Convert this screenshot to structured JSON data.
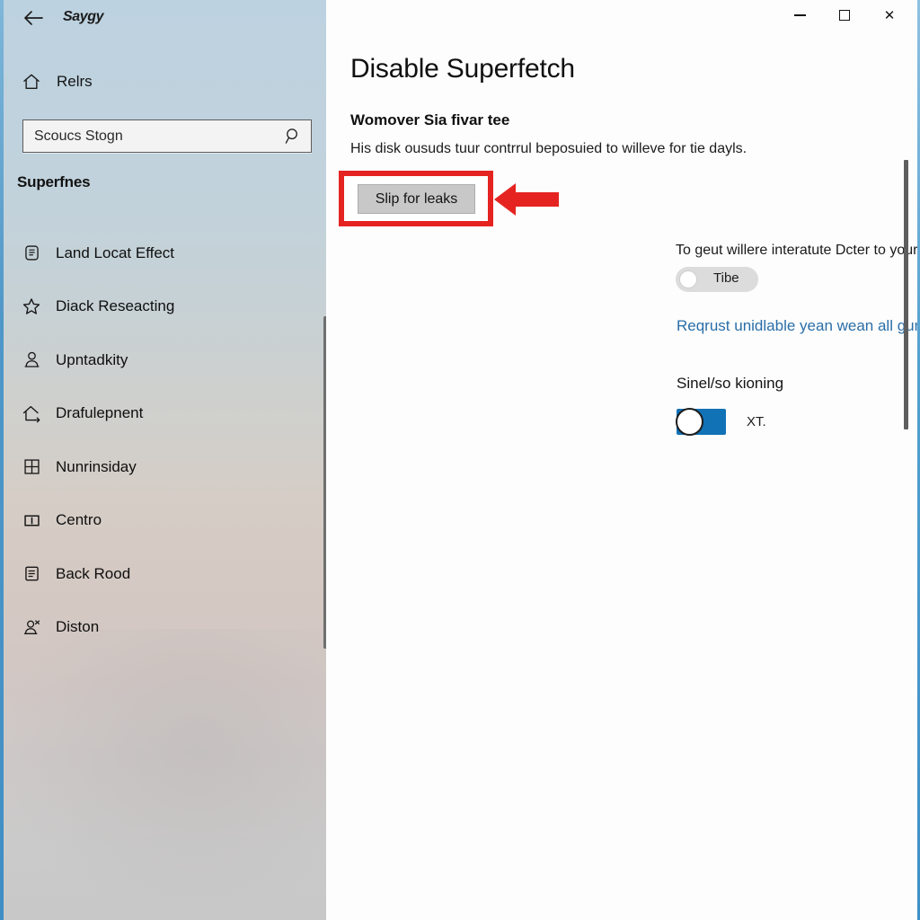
{
  "window": {
    "title": "Saygy",
    "back_icon": "back-arrow-icon",
    "minimize_label": "Minimize",
    "maximize_label": "Maximize",
    "close_label": "Close",
    "close_glyph": "✕"
  },
  "sidebar": {
    "home": {
      "label": "Relrs",
      "icon": "home-icon"
    },
    "search": {
      "value": "Scoucs Stogn",
      "placeholder": "Scoucs Stogn",
      "icon": "search-icon"
    },
    "group_header": "Superfnes",
    "items": [
      {
        "label": "Land Locat Effect",
        "icon": "badge-icon"
      },
      {
        "label": "Diack Reseacting",
        "icon": "star-icon"
      },
      {
        "label": "Upntadkity",
        "icon": "person-icon"
      },
      {
        "label": "Drafulepnent",
        "icon": "home-upload-icon"
      },
      {
        "label": "Nunrinsiday",
        "icon": "grid-icon"
      },
      {
        "label": "Centro",
        "icon": "panel-icon"
      },
      {
        "label": "Back Rood",
        "icon": "document-icon"
      },
      {
        "label": "Diston",
        "icon": "person-share-icon"
      }
    ]
  },
  "main": {
    "page_title": "Disable Superfetch",
    "section_heading": "Womover Sia fivar tee",
    "section_description": "His disk ousuds tuur contrrul beposuied to willeve for tie dayls.",
    "action_button": "Slip for leaks",
    "sub_description": "To geut willere interatute Dcter to your fumasseg.",
    "toggle_off": {
      "label": "Tibe",
      "state": "off"
    },
    "link": "Reqrust unidlable yean wean all gume",
    "sub_heading": "Sinel/so kioning",
    "toggle_on": {
      "label": "XT.",
      "state": "on"
    }
  },
  "colors": {
    "accent_blue": "#1272b6",
    "link_blue": "#2a6ea8",
    "callout_red": "#e52421",
    "button_gray": "#c8c8c8"
  }
}
